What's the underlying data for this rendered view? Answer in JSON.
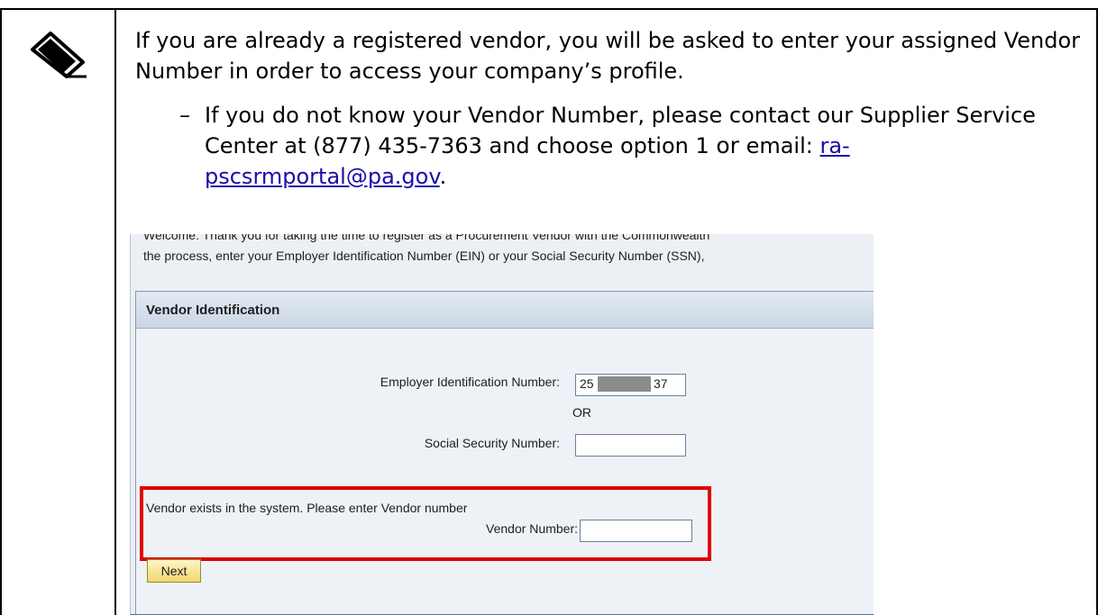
{
  "note": {
    "paragraph": "If you are already a registered vendor, you will be asked to enter your assigned Vendor Number in order to access your company’s profile.",
    "bullet_symbol": "–",
    "bullet_text_before_or": "If you do not know your Vendor Number, please contact our Supplier Service Center at (877) 435-7363 and choose option 1 ",
    "bullet_or": "or",
    "bullet_email_prefix": " email: ",
    "email_link_line1": "ra-",
    "email_link_line2": "pscsrmportal@pa.gov",
    "trailing_period": "."
  },
  "screenshot": {
    "intro_line1": "Welcome: Thank you for taking the time to register as a Procurement Vendor with the Commonwealth",
    "intro_line2": "the process, enter your Employer Identification Number (EIN) or your Social Security Number (SSN),",
    "section_title": "Vendor Identification",
    "ein_label": "Employer Identification Number:",
    "ein_value_start": "25",
    "ein_value_end": "37",
    "or_label": "OR",
    "ssn_label": "Social Security Number:",
    "ssn_value": "",
    "exists_message": "Vendor exists in the system. Please enter Vendor number",
    "vendor_number_label": "Vendor Number:",
    "vendor_number_value": "",
    "next_button": "Next"
  },
  "colors": {
    "highlight_border": "#e00000",
    "link": "#1a0dab",
    "button_fill": "#f1d56e"
  },
  "icons": {
    "note_icon": "pen-writing-icon"
  }
}
